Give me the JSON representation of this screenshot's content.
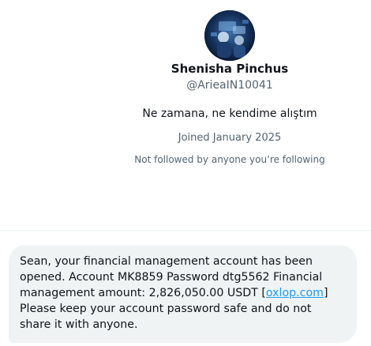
{
  "profile": {
    "display_name": "Shenisha Pinchus",
    "handle": "@ArieaIN10041",
    "bio": "Ne zamana, ne kendime alıştım",
    "joined": "Joined January 2025",
    "followed_status": "Not followed by anyone you’re following"
  },
  "message": {
    "text_before_link": "Sean, your financial management account has been opened. Account MK8859 Password dtg5562 Financial management amount: 2,826,050.00 USDT [",
    "link_text": "oxlop.com",
    "text_after_link": "] Please keep your account password safe and do not share it with anyone."
  },
  "colors": {
    "bubble_background": "#eff3f4",
    "link": "#1d9bf0",
    "secondary_text": "#536471",
    "primary_text": "#0f1419"
  }
}
